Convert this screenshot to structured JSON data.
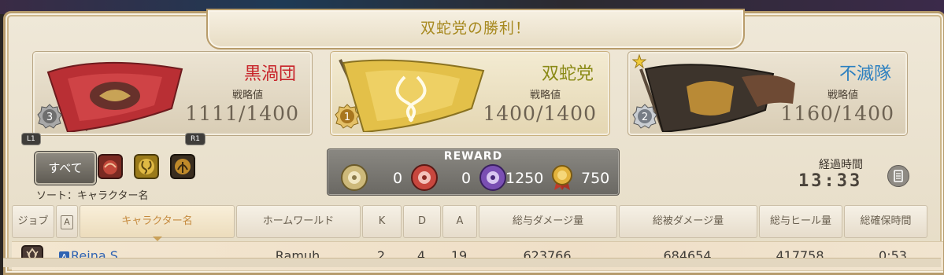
{
  "title": "双蛇党の勝利！",
  "teams": [
    {
      "name": "黒渦団",
      "label": "戦略値",
      "score": "1111/1400",
      "rank": "3",
      "name_color": "#c8242a",
      "winner": false
    },
    {
      "name": "双蛇党",
      "label": "戦略値",
      "score": "1400/1400",
      "rank": "1",
      "name_color": "#8a8a16",
      "winner": true
    },
    {
      "name": "不滅隊",
      "label": "戦略値",
      "score": "1160/1400",
      "rank": "2",
      "name_color": "#2a7fc0",
      "winner": false
    }
  ],
  "filters": {
    "all_label": "すべて",
    "l1": "L1",
    "r1": "R1",
    "icons": [
      "maelstrom-icon",
      "twin-adder-icon",
      "immortal-flames-icon"
    ],
    "sort_label": "ソート：キャラクター名"
  },
  "reward": {
    "title": "REWARD",
    "items": [
      {
        "icon": "gold-seal-icon",
        "value": "0"
      },
      {
        "icon": "red-seal-icon",
        "value": "0"
      },
      {
        "icon": "purple-seal-icon",
        "value": "1250"
      },
      {
        "icon": "medal-icon",
        "value": "750"
      }
    ]
  },
  "elapsed": {
    "label": "経過時間",
    "time": "13:33"
  },
  "table": {
    "headers": [
      "ジョブ",
      "A",
      "キャラクター名",
      "ホームワールド",
      "K",
      "D",
      "A",
      "総与ダメージ量",
      "総被ダメージ量",
      "総与ヒール量",
      "総確保時間"
    ],
    "rows": [
      {
        "job": "job-icon",
        "alliance": "A",
        "name": "Reina S.",
        "world": "Ramuh",
        "k": "2",
        "d": "4",
        "a": "19",
        "dmg_dealt": "623766",
        "dmg_taken": "684654",
        "heal": "417758",
        "time": "0:53"
      }
    ]
  }
}
